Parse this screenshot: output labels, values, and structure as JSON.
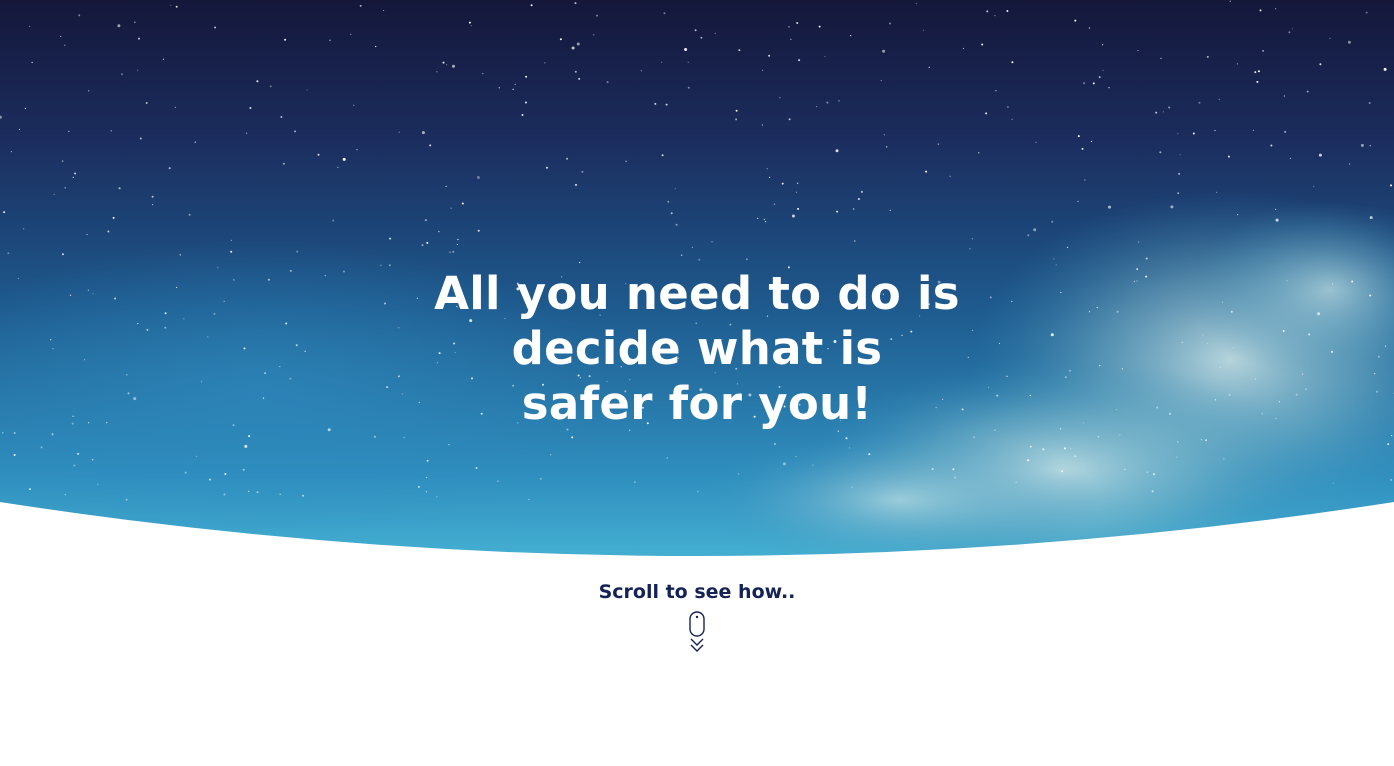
{
  "hero": {
    "headline_lines": [
      "All you need to do is",
      "decide what is",
      "safer for you!"
    ],
    "background": "starry-night-sky-with-clouds"
  },
  "scroll_prompt": {
    "label": "Scroll to see how..",
    "icon": "mouse-scroll-down-icon"
  },
  "colors": {
    "sky_top": "#15193d",
    "sky_mid": "#1f5a8c",
    "sky_bottom": "#3aa0c6",
    "headline_text": "#ffffff",
    "accent_navy": "#152257",
    "page_background": "#ffffff"
  }
}
